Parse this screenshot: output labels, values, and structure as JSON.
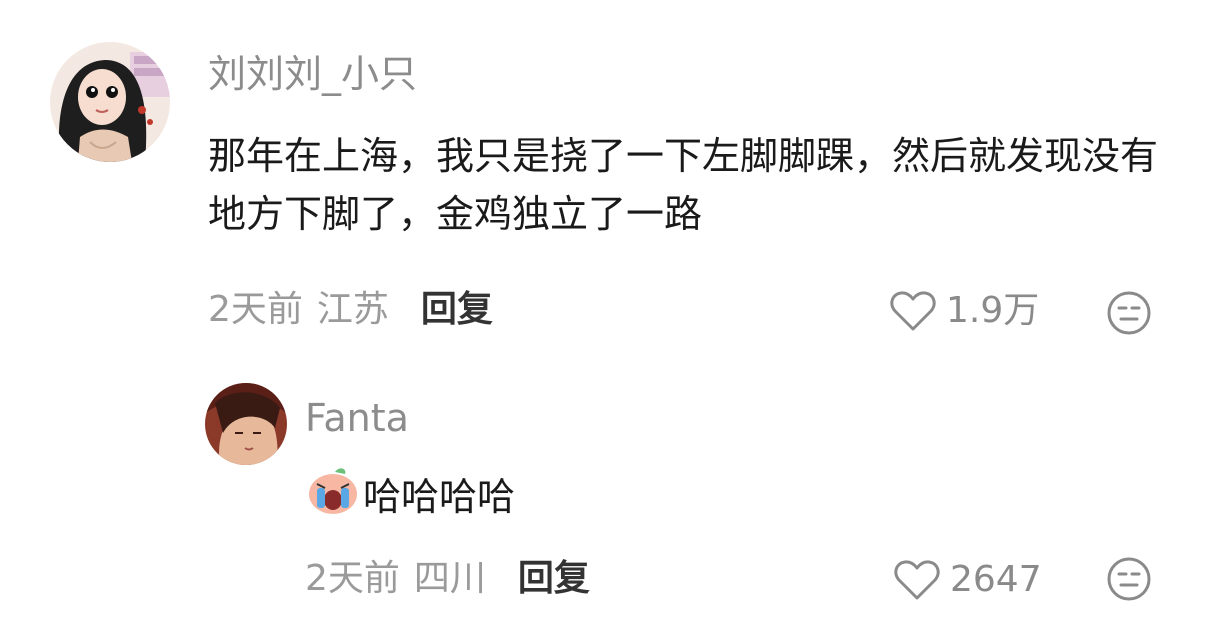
{
  "comments": [
    {
      "username": "刘刘刘_小只",
      "text": "那年在上海，我只是挠了一下左脚脚踝，然后就发现没有地方下脚了，金鸡独立了一路",
      "time": "2天前",
      "location": "江苏",
      "reply_label": "回复",
      "likes": "1.9万",
      "avatar_icon": "avatar-girl-illustration"
    },
    {
      "username": "Fanta",
      "text": "哈哈哈哈",
      "emoji_icon": "crying-laughing-sticker-icon",
      "time": "2天前",
      "location": "四川",
      "reply_label": "回复",
      "likes": "2647",
      "avatar_icon": "avatar-painted-portrait"
    }
  ],
  "icons": {
    "like": "heart-outline-icon",
    "react": "neutral-face-icon"
  }
}
